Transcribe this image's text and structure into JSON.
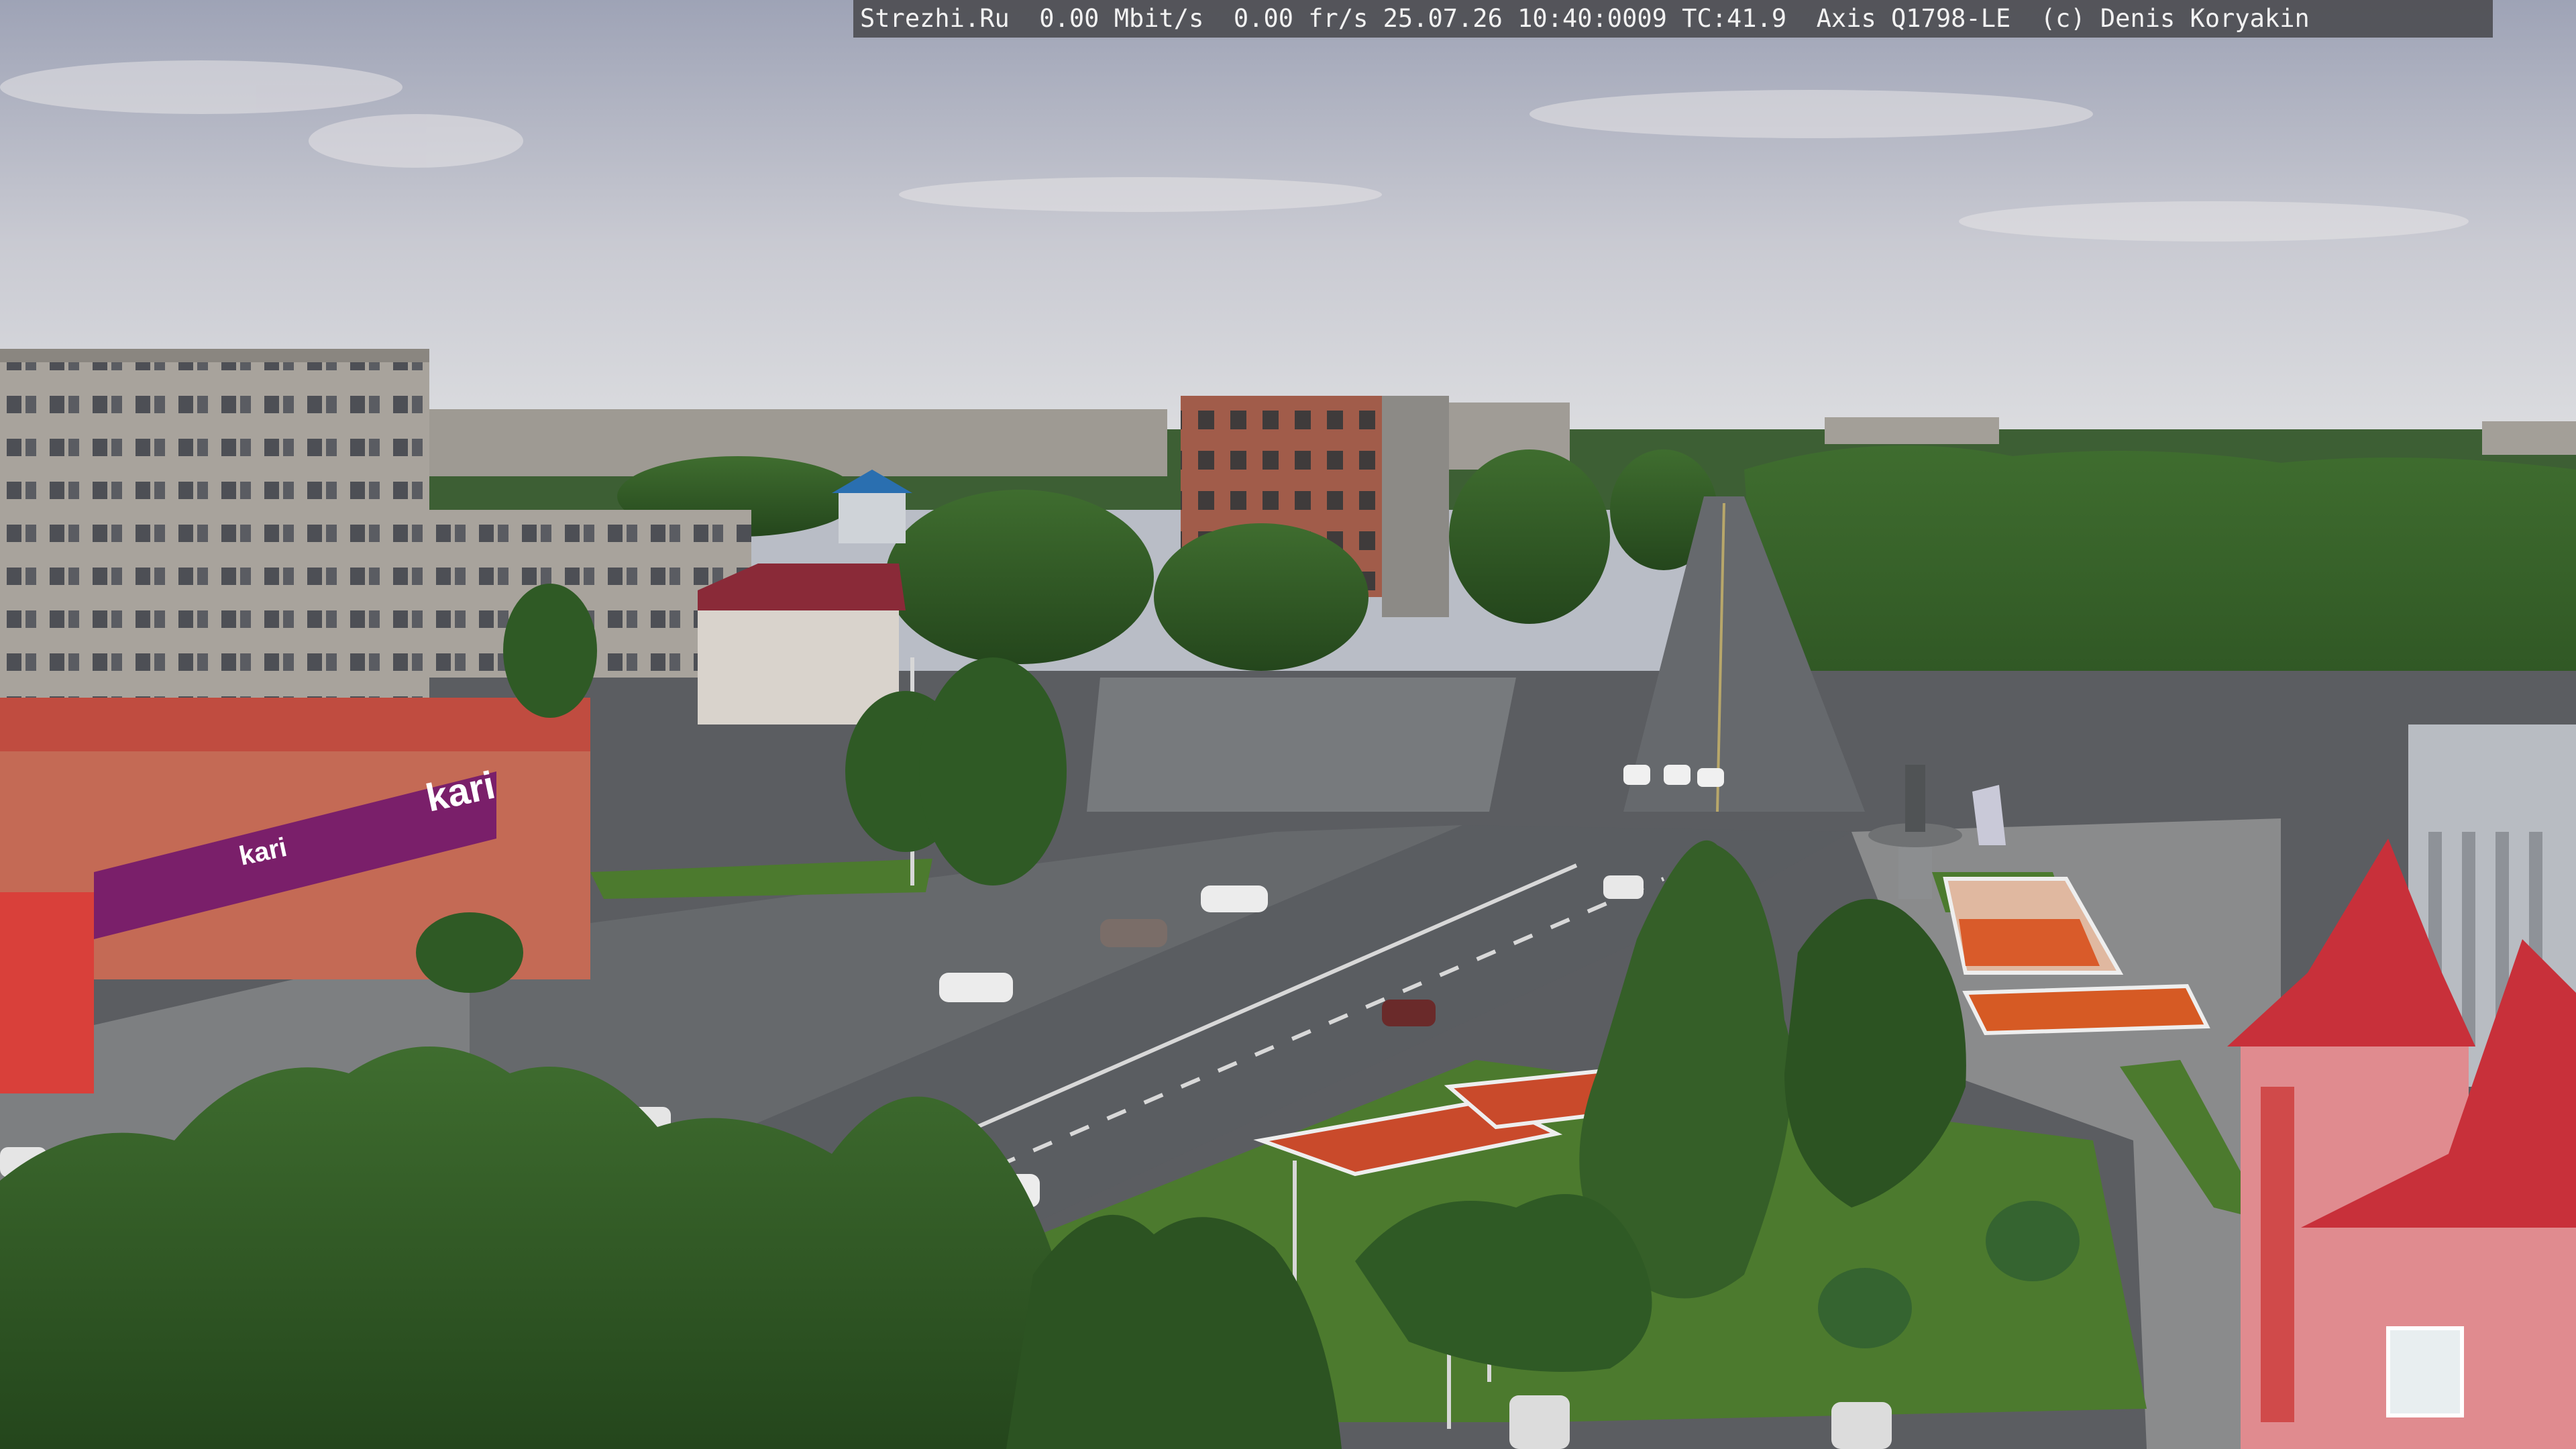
{
  "overlay": {
    "text": "Strezhi.Ru  0.00 Mbit/s  0.00 fr/s 25.07.26 10:40:0009 TC:41.9  Axis Q1798-LE  (c) Denis Koryakin"
  },
  "signs": {
    "store_logo": "kari",
    "store_logo_small": "kari"
  },
  "colors": {
    "sky_top": "#a9adbd",
    "sky_bottom": "#d8dade",
    "asphalt": "#5d6064",
    "plaza": "#6b6d70",
    "grass": "#4f7a34",
    "trees": "#2f5a25",
    "brick": "#b05a4a",
    "store_red": "#d9403a",
    "store_purple": "#7a1f6a",
    "roof_red": "#c8303a"
  }
}
